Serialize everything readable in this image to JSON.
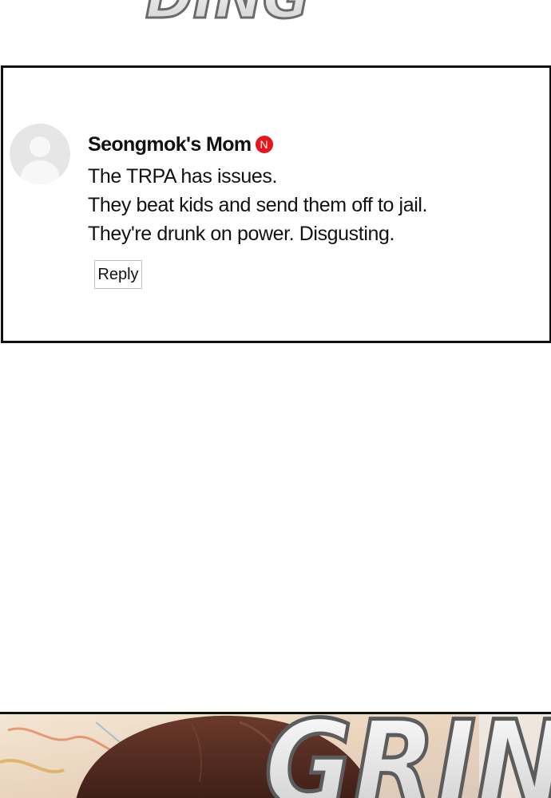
{
  "top_sfx": {
    "text": "DING"
  },
  "comment": {
    "author": "Seongmok's Mom",
    "badge": "N",
    "lines": [
      "The TRPA has issues.",
      "They beat kids and send them off to jail.",
      "They're drunk on power. Disgusting."
    ],
    "reply_label": "Reply"
  },
  "bottom_panel": {
    "sfx": "GRIN"
  },
  "colors": {
    "badge": "#e8161c",
    "panel_border": "#111111",
    "avatar_bg": "#e6e6e6",
    "hair": "#5a2e22",
    "sfx_fill": "#d9d9d9"
  }
}
